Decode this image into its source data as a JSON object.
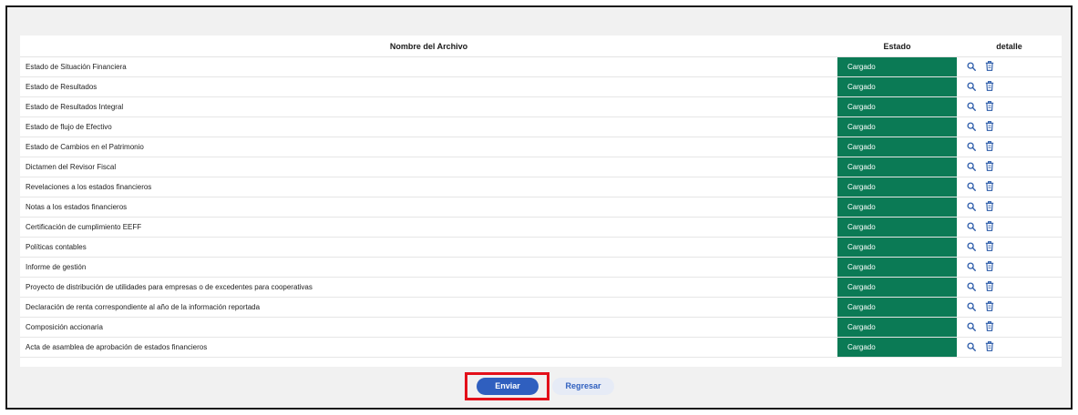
{
  "table": {
    "headers": {
      "name": "Nombre del Archivo",
      "status": "Estado",
      "detail": "detalle"
    },
    "rows": [
      {
        "name": "Estado de Situación Financiera",
        "status": "Cargado"
      },
      {
        "name": "Estado de Resultados",
        "status": "Cargado"
      },
      {
        "name": "Estado de Resultados Integral",
        "status": "Cargado"
      },
      {
        "name": "Estado de flujo de Efectivo",
        "status": "Cargado"
      },
      {
        "name": "Estado de Cambios en el Patrimonio",
        "status": "Cargado"
      },
      {
        "name": "Dictamen del Revisor Fiscal",
        "status": "Cargado"
      },
      {
        "name": "Revelaciones a los estados financieros",
        "status": "Cargado"
      },
      {
        "name": "Notas a los estados financieros",
        "status": "Cargado"
      },
      {
        "name": "Certificación de cumplimiento EEFF",
        "status": "Cargado"
      },
      {
        "name": "Políticas contables",
        "status": "Cargado"
      },
      {
        "name": "Informe de gestión",
        "status": "Cargado"
      },
      {
        "name": "Proyecto de distribución de utilidades para empresas o de excedentes para cooperativas",
        "status": "Cargado"
      },
      {
        "name": "Declaración de renta correspondiente al año de la información reportada",
        "status": "Cargado"
      },
      {
        "name": "Composición accionaria",
        "status": "Cargado"
      },
      {
        "name": "Acta de asamblea de aprobación de estados financieros",
        "status": "Cargado"
      }
    ],
    "row_icons": [
      "search-icon",
      "trash-icon"
    ]
  },
  "actions": {
    "send_label": "Enviar",
    "back_label": "Regresar"
  },
  "colors": {
    "status_green": "#0b7a55",
    "primary_blue": "#2f5fbf",
    "highlight_red": "#e3101a",
    "icon_blue": "#2a5aa8"
  }
}
